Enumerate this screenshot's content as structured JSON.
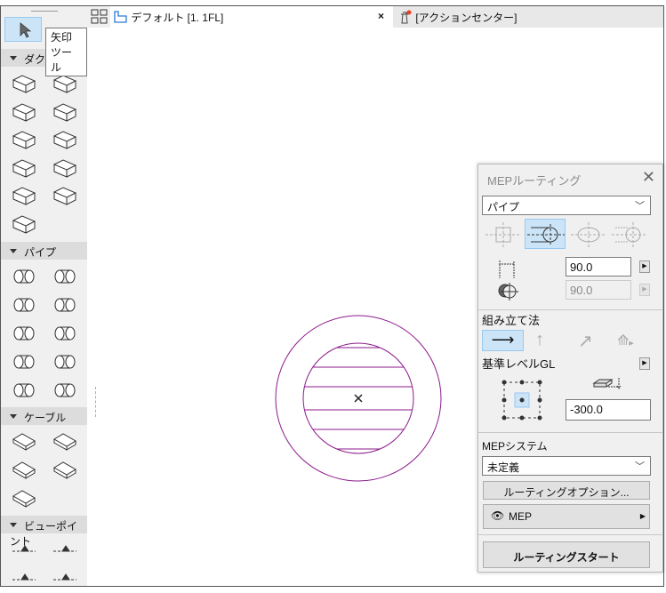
{
  "toolbox": {
    "tooltip": "矢印ツール",
    "sections": [
      {
        "label": "ダクト",
        "icons": [
          "duct-straight-icon",
          "duct-flex-icon",
          "duct-elbow-icon",
          "duct-transition-icon",
          "duct-branch-icon",
          "duct-takeoff-icon",
          "duct-tee-icon",
          "duct-cross-icon",
          "duct-terminal-icon",
          "duct-equipment-icon",
          "duct-damper-icon"
        ]
      },
      {
        "label": "パイプ",
        "icons": [
          "pipe-straight-icon",
          "pipe-elbow-icon",
          "pipe-flex-icon",
          "pipe-transition-icon",
          "pipe-branch-icon",
          "pipe-takeoff-icon",
          "pipe-tee-icon",
          "pipe-valve-icon",
          "pipe-terminal-icon",
          "pipe-equipment-icon"
        ]
      },
      {
        "label": "ケーブル",
        "icons": [
          "cable-tray-straight-icon",
          "cable-tray-elbow-icon",
          "cable-tray-branch-icon",
          "cable-tray-tee-icon",
          "cable-tray-cross-icon"
        ]
      },
      {
        "label": "ビューポイント",
        "icons": [
          "elevation-marker-icon",
          "section-marker-icon",
          "detail-marker-icon",
          "worksheet-marker-icon"
        ]
      }
    ]
  },
  "tabs": [
    {
      "label": "デフォルト [1. 1FL]",
      "close": "×"
    },
    {
      "label": "[アクションセンター]"
    }
  ],
  "panel": {
    "title": "MEPルーティング",
    "type_select": "パイプ",
    "width_value": "90.0",
    "height_value": "90.0",
    "assembly_label": "組み立て法",
    "reference_label": "基準レベルGL",
    "offset_value": "-300.0",
    "system_label": "MEPシステム",
    "system_select": "未定義",
    "options_button": "ルーティングオプション...",
    "layer_button": "MEP",
    "start_button": "ルーティングスタート"
  },
  "colors": {
    "accent": "#cce4f7",
    "pipe": "#8b1a8b"
  }
}
